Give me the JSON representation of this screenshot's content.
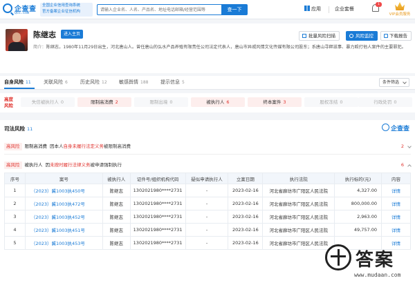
{
  "colors": {
    "brand": "#1a7bd6",
    "risk_red": "#e0322d",
    "vip_gold": "#e89b20"
  },
  "header": {
    "logo_text": "企查查",
    "logo_sub": "Qcc.com",
    "slogan_lines": [
      "全国企业信用查询系统",
      "官方备案企业征信机构"
    ],
    "search_placeholder": "请输入企业名、人名、产品名、地址电话邮箱/经营范围等",
    "search_button": "查一下",
    "nav_app": "应用",
    "nav_suite": "企业套餐",
    "notification_count": "1",
    "vip_label": "VIP会员服务"
  },
  "profile": {
    "name": "陈继志",
    "enter_home_label": "进入主页",
    "scan_label": "批量风险扫描",
    "monitor_label": "风险监控",
    "report_label": "下载报告",
    "intro_label": "简介：",
    "intro_text": "陈继志，1980年11月29日出生，河北唐山人。曾任唐山的弘水产品养殖有限责任公司法定代表人，唐山市异戚风情文化传媒有限公司股东；系唐山寻衅滋事、暴力殴打他人案件的主要罪犯。"
  },
  "tabs": {
    "items": [
      {
        "label": "自身风险",
        "count": "11"
      },
      {
        "label": "关联风险",
        "count": "6"
      },
      {
        "label": "历史风险",
        "count": "12"
      },
      {
        "label": "敏感舆情",
        "count": "188"
      },
      {
        "label": "提示信息",
        "count": "5"
      }
    ],
    "filter_label": "条件筛选"
  },
  "risk_bar": {
    "title": "高度 风险",
    "chips": [
      {
        "label": "失信被执行人",
        "count": "0"
      },
      {
        "label": "限制高消费",
        "count": "2"
      },
      {
        "label": "限制出境",
        "count": "0"
      },
      {
        "label": "被执行人",
        "count": "6"
      },
      {
        "label": "终本案件",
        "count": "3"
      },
      {
        "label": "股权冻结",
        "count": "0"
      },
      {
        "label": "行政处罚",
        "count": "0"
      }
    ]
  },
  "content": {
    "section_title": "司法风险",
    "section_count": "11",
    "watermark_logo": "企查查",
    "risk_lines": [
      {
        "tag": "高风险",
        "type": "限制高消费",
        "pre": "因本人",
        "red": "自身未履行法定义务",
        "post": "被限制高消费",
        "count": "2"
      },
      {
        "tag": "高风险",
        "type": "被执行人",
        "pre": "因",
        "red": "未按时履行法律义务",
        "post": "被申请强制执行",
        "count": "6"
      }
    ],
    "table": {
      "headers": [
        "序号",
        "案号",
        "被执行人",
        "证件号/组织机构代码",
        "疑似申请执行人",
        "立案日期",
        "执行法院",
        "执行标的(元)",
        "内容"
      ],
      "rows": [
        [
          "1",
          "（2023）冀1003执450号",
          "陈继志",
          "1302021980****2731",
          "-",
          "2023-02-16",
          "河北省廊坊市广阳区人民法院",
          "4,327.00",
          "详情"
        ],
        [
          "2",
          "（2023）冀1003执472号",
          "陈继志",
          "1302021980****2731",
          "-",
          "2023-02-16",
          "河北省廊坊市广阳区人民法院",
          "800,000.00",
          "详情"
        ],
        [
          "3",
          "（2023）冀1003执452号",
          "陈继志",
          "1302021980****2731",
          "-",
          "2023-02-16",
          "河北省廊坊市广阳区人民法院",
          "2,963.00",
          "详情"
        ],
        [
          "4",
          "（2023）冀1003执451号",
          "陈继志",
          "1302021980****2731",
          "-",
          "2023-02-16",
          "河北省廊坊市广阳区人民法院",
          "49,757.00",
          "详情"
        ],
        [
          "5",
          "（2023）冀1003执453号",
          "陈继志",
          "1302021980****2731",
          "-",
          "2023-02-16",
          "河北省廊坊市广阳区人民法院",
          "",
          "详情"
        ]
      ]
    }
  },
  "watermark": {
    "text": "答案",
    "url": "www.mudaan.com"
  }
}
